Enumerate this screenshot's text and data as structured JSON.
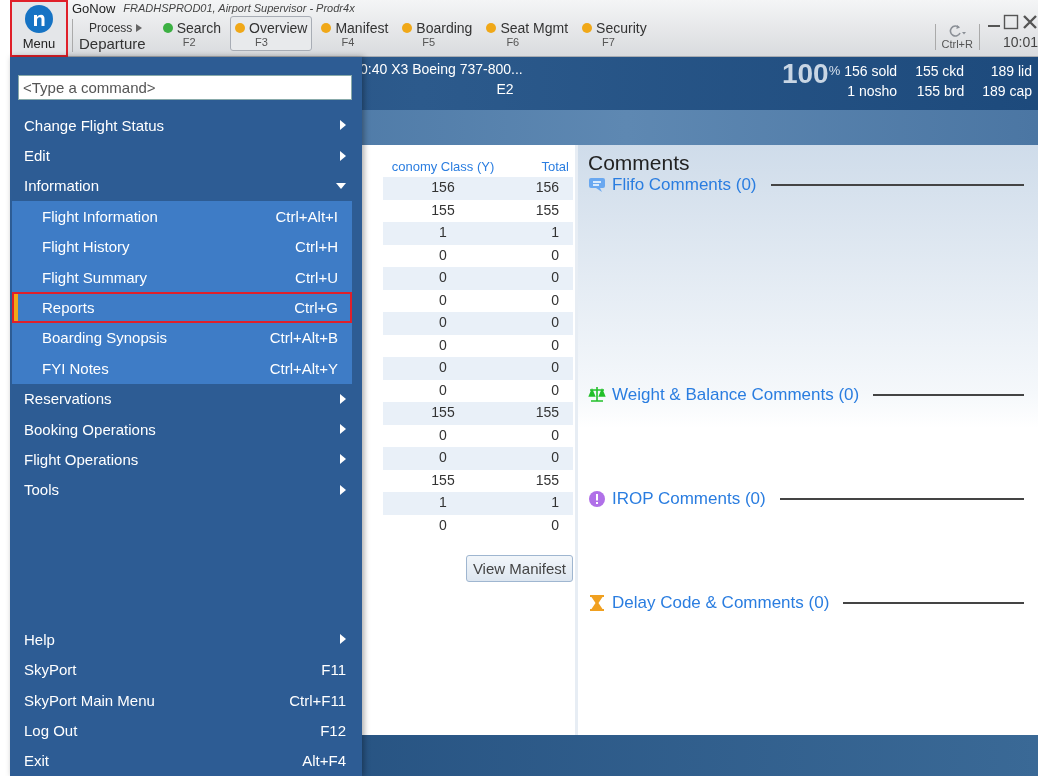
{
  "toolbar": {
    "menu_button": {
      "label": "Menu",
      "highlighted": true
    },
    "app_title": "GoNow",
    "session": "FRADHSPROD01, Airport Supervisor - Prodr4x",
    "process": {
      "label": "Process",
      "value": "Departure"
    },
    "tabs": [
      {
        "label": "Search",
        "key": "F2",
        "color": "#3cb043",
        "selected": false
      },
      {
        "label": "Overview",
        "key": "F3",
        "color": "#f0a818",
        "selected": true
      },
      {
        "label": "Manifest",
        "key": "F4",
        "color": "#f0a818",
        "selected": false
      },
      {
        "label": "Boarding",
        "key": "F5",
        "color": "#f0a818",
        "selected": false
      },
      {
        "label": "Seat Mgmt",
        "key": "F6",
        "color": "#f0a818",
        "selected": false
      },
      {
        "label": "Security",
        "key": "F7",
        "color": "#f0a818",
        "selected": false
      }
    ],
    "refresh_key": "Ctrl+R",
    "time": "10:01"
  },
  "flight_header": {
    "summary": "0:40 X3 Boeing 737-800...",
    "gate": "E2",
    "load_value": "100",
    "load_unit": "%",
    "stats": [
      [
        "156 sold",
        "155 ckd",
        "189 lid"
      ],
      [
        "1 nosho",
        "155 brd",
        "189 cap"
      ]
    ]
  },
  "manifest_table": {
    "columns": [
      "conomy Class (Y)",
      "Total"
    ],
    "rows": [
      [
        "156",
        "156"
      ],
      [
        "155",
        "155"
      ],
      [
        "1",
        "1"
      ],
      [
        "0",
        "0"
      ],
      [
        "0",
        "0"
      ],
      [
        "0",
        "0"
      ],
      [
        "0",
        "0"
      ],
      [
        "0",
        "0"
      ],
      [
        "0",
        "0"
      ],
      [
        "0",
        "0"
      ],
      [
        "155",
        "155"
      ],
      [
        "0",
        "0"
      ],
      [
        "0",
        "0"
      ],
      [
        "155",
        "155"
      ],
      [
        "1",
        "1"
      ],
      [
        "0",
        "0"
      ]
    ],
    "button": "View Manifest"
  },
  "comments": {
    "title": "Comments",
    "sections": [
      {
        "kind": "chat",
        "label": "Flifo Comments (0)"
      },
      {
        "kind": "scale",
        "label": "Weight & Balance Comments (0)"
      },
      {
        "kind": "alert",
        "label": "IROP Comments (0)"
      },
      {
        "kind": "hourglass",
        "label": "Delay Code & Comments (0)"
      }
    ]
  },
  "menu": {
    "command_placeholder": "<Type a command>",
    "items": [
      {
        "kind": "submenu",
        "label": "Change Flight Status"
      },
      {
        "kind": "submenu",
        "label": "Edit"
      },
      {
        "kind": "group",
        "label": "Information",
        "expanded": true,
        "children": [
          {
            "label": "Flight Information",
            "shortcut": "Ctrl+Alt+I",
            "selected": false
          },
          {
            "label": "Flight History",
            "shortcut": "Ctrl+H",
            "selected": false
          },
          {
            "label": "Flight Summary",
            "shortcut": "Ctrl+U",
            "selected": false
          },
          {
            "label": "Reports",
            "shortcut": "Ctrl+G",
            "selected": true
          },
          {
            "label": "Boarding Synopsis",
            "shortcut": "Ctrl+Alt+B",
            "selected": false
          },
          {
            "label": "FYI Notes",
            "shortcut": "Ctrl+Alt+Y",
            "selected": false
          }
        ]
      },
      {
        "kind": "submenu",
        "label": "Reservations"
      },
      {
        "kind": "submenu",
        "label": "Booking Operations"
      },
      {
        "kind": "submenu",
        "label": "Flight Operations"
      },
      {
        "kind": "submenu",
        "label": "Tools"
      },
      {
        "kind": "spacer"
      },
      {
        "kind": "submenu",
        "label": "Help"
      },
      {
        "kind": "command",
        "label": "SkyPort",
        "shortcut": "F11"
      },
      {
        "kind": "command",
        "label": "SkyPort Main Menu",
        "shortcut": "Ctrl+F11"
      },
      {
        "kind": "command",
        "label": "Log Out",
        "shortcut": "F12"
      },
      {
        "kind": "command",
        "label": "Exit",
        "shortcut": "Alt+F4"
      }
    ]
  }
}
